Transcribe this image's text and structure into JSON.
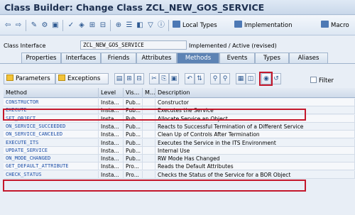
{
  "window": {
    "title": "Class Builder: Change Class ZCL_NEW_GOS_SERVICE"
  },
  "toolbar": {
    "icons": [
      "back-icon",
      "forward-icon",
      "edit-icon",
      "display-change-icon",
      "other-object-icon",
      "check-icon",
      "activate-icon",
      "where-used-icon",
      "hierarchy-icon",
      "navigate-icon",
      "list-icon",
      "enhance-icon",
      "filter-icon",
      "info-icon"
    ],
    "local_types": "Local Types",
    "implementation": "Implementation",
    "macros": "Macro"
  },
  "header": {
    "class_interface_label": "Class Interface",
    "class_interface_value": "ZCL_NEW_GOS_SERVICE",
    "status": "Implemented / Active (revised)"
  },
  "tabs": [
    {
      "label": "Properties",
      "active": false
    },
    {
      "label": "Interfaces",
      "active": false
    },
    {
      "label": "Friends",
      "active": false
    },
    {
      "label": "Attributes",
      "active": false
    },
    {
      "label": "Methods",
      "active": true
    },
    {
      "label": "Events",
      "active": false
    },
    {
      "label": "Types",
      "active": false
    },
    {
      "label": "Aliases",
      "active": false
    }
  ],
  "buttons": {
    "parameters": "Parameters",
    "exceptions": "Exceptions",
    "filter": "Filter"
  },
  "grid": {
    "columns": [
      "Method",
      "Level",
      "Vis...",
      "M...",
      "Description"
    ],
    "rows": [
      {
        "method": "CONSTRUCTOR",
        "level": "Insta...",
        "vis": "Pub...",
        "description": "Constructor"
      },
      {
        "method": "EXECUTE",
        "level": "Insta...",
        "vis": "Pub...",
        "description": "Executes the Service"
      },
      {
        "method": "SET_OBJECT",
        "level": "Insta...",
        "vis": "Pub...",
        "description": "Allocate Service an Object"
      },
      {
        "method": "ON_SERVICE_SUCCEEDED",
        "level": "Insta...",
        "vis": "Pub...",
        "description": "Reacts to Successful Termination of a Different Service"
      },
      {
        "method": "ON_SERVICE_CANCELED",
        "level": "Insta...",
        "vis": "Pub...",
        "description": "Clean Up of Controls After Termination"
      },
      {
        "method": "EXECUTE_ITS",
        "level": "Insta...",
        "vis": "Pub...",
        "description": "Executes the Service in the ITS Environment"
      },
      {
        "method": "UPDATE_SERVICE",
        "level": "Insta...",
        "vis": "Pub...",
        "description": "Internal Use"
      },
      {
        "method": "ON_MODE_CHANGED",
        "level": "Insta...",
        "vis": "Pub...",
        "description": "RW Mode Has Changed"
      },
      {
        "method": "GET_DEFAULT_ATTRIBUTE",
        "level": "Insta...",
        "vis": "Pro...",
        "description": "Reads the Default Attributes"
      },
      {
        "method": "CHECK_STATUS",
        "level": "Insta...",
        "vis": "Pro...",
        "description": "Checks the Status of the Service for a BOR Object"
      }
    ]
  },
  "colors": {
    "accent": "#5d83b4",
    "highlight": "#c4182c"
  }
}
